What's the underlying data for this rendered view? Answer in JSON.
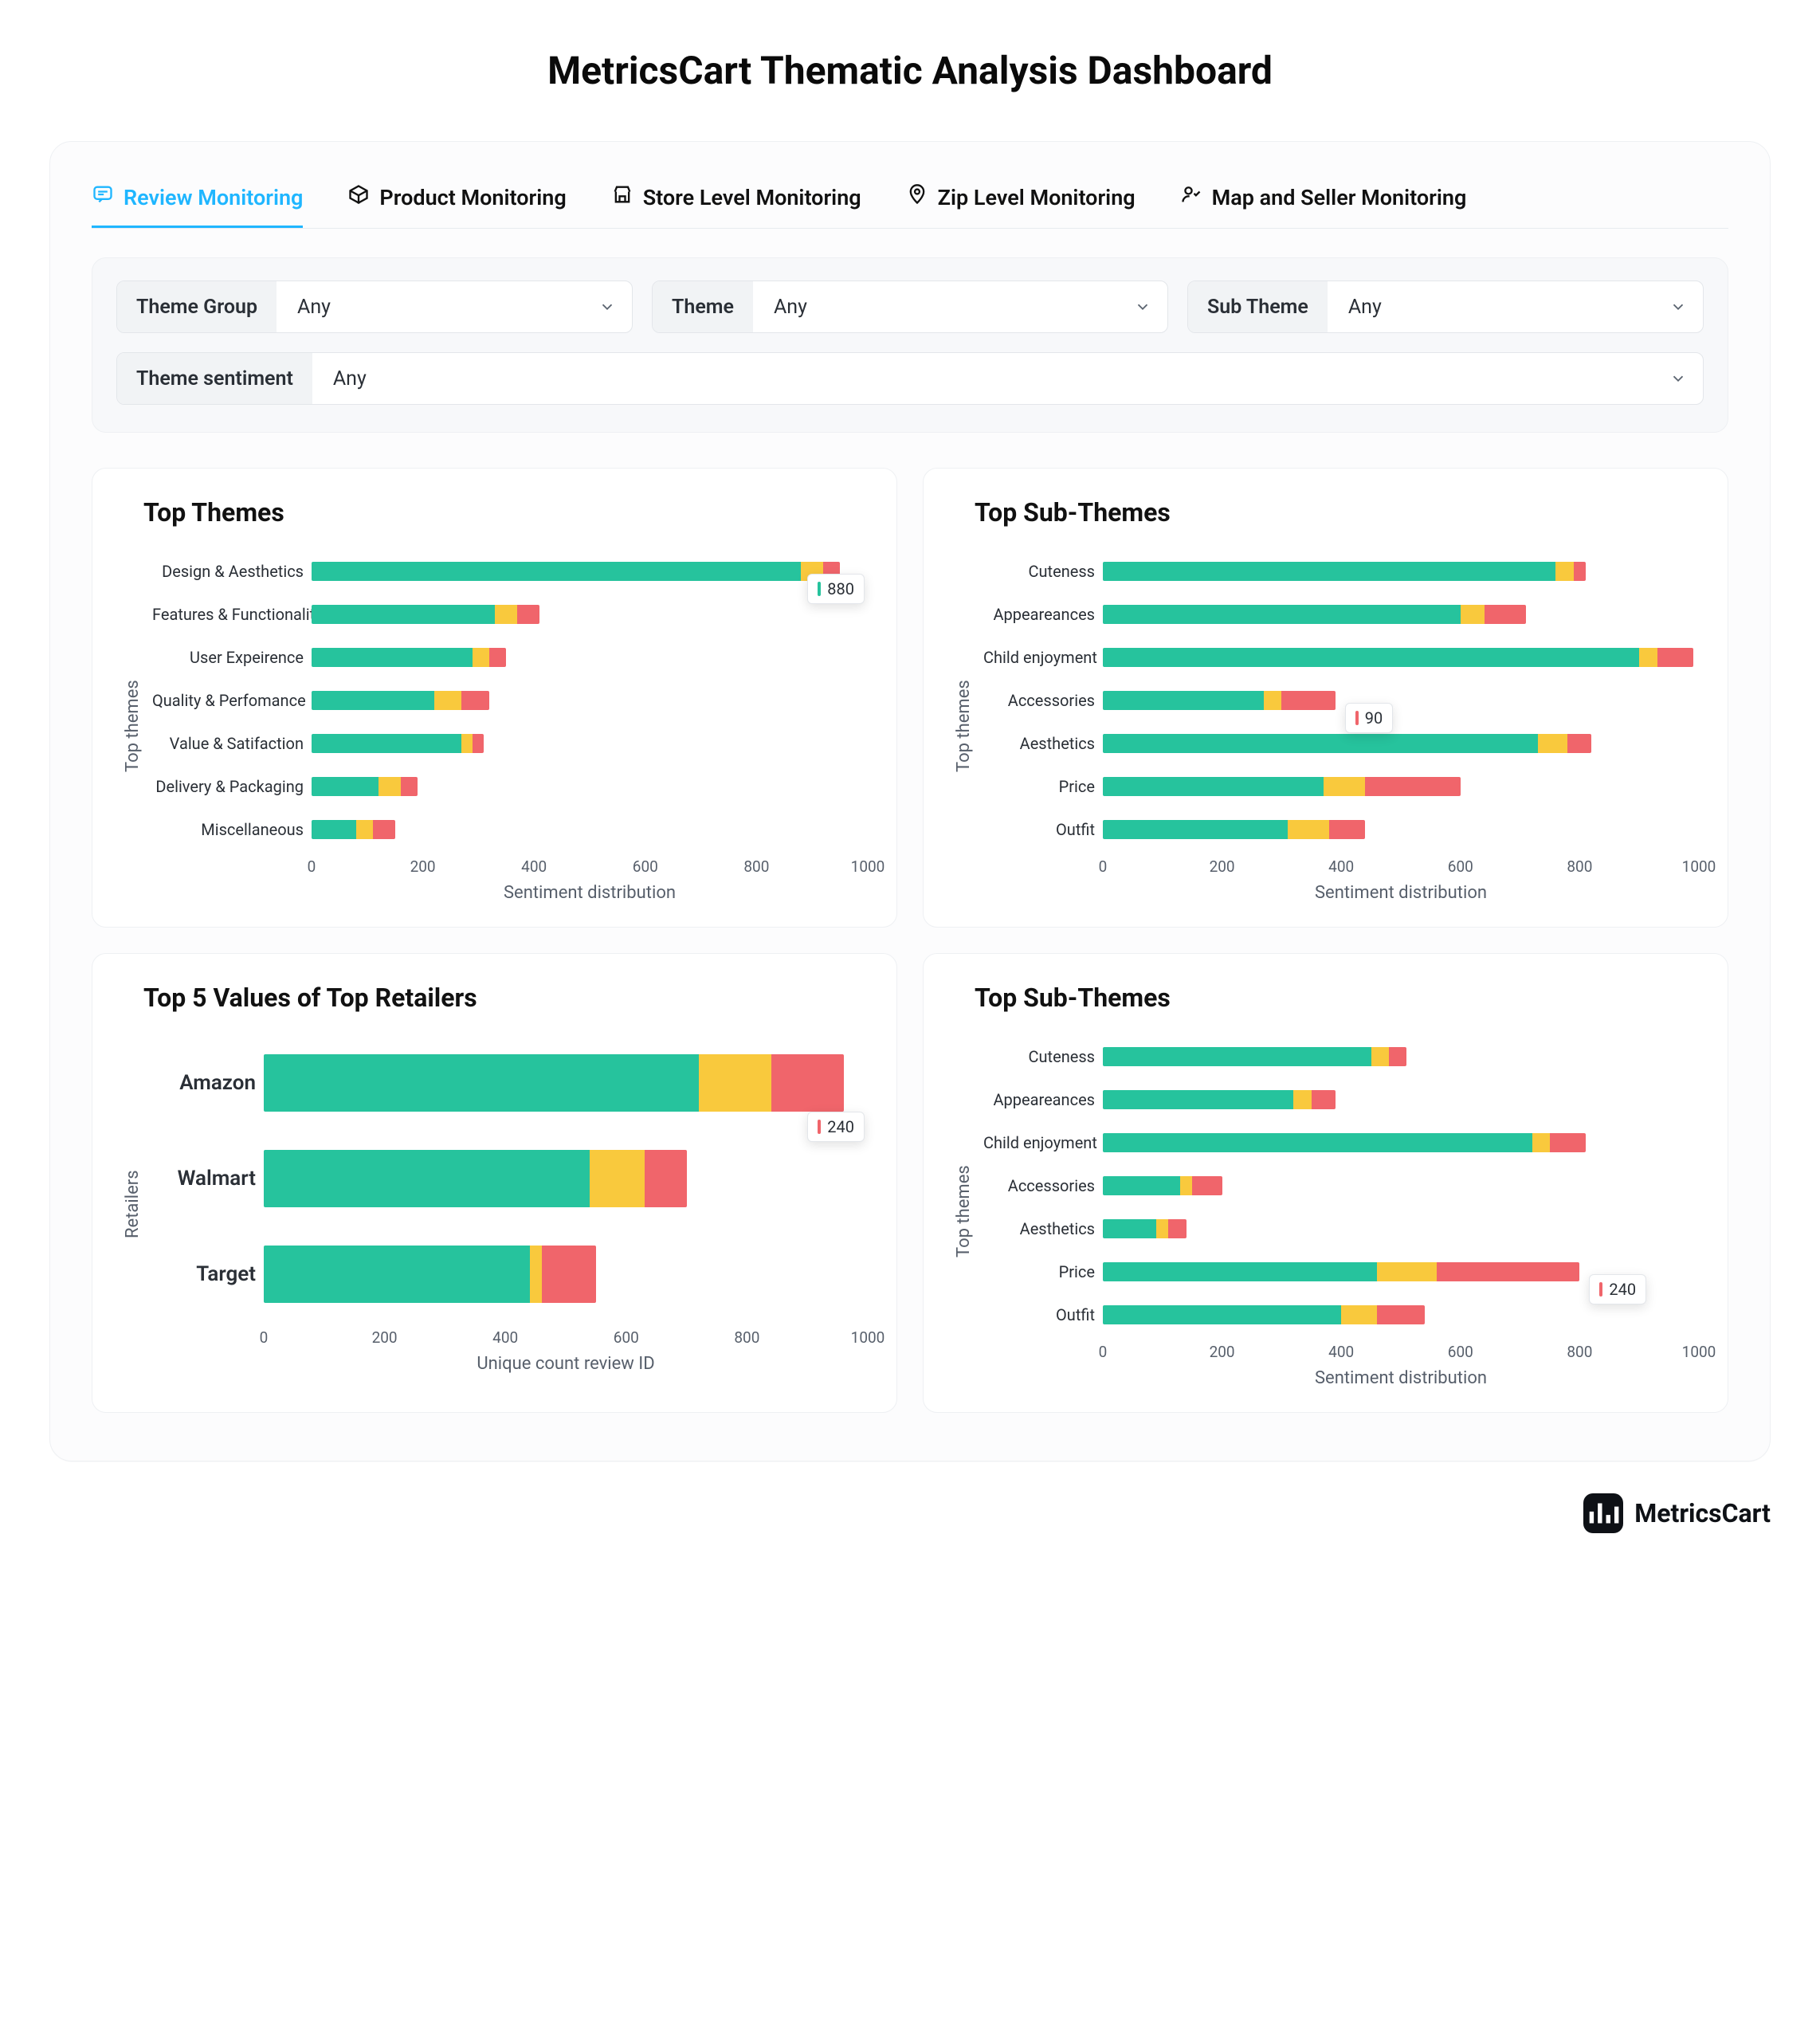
{
  "page": {
    "title": "MetricsCart Thematic Analysis Dashboard"
  },
  "tabs": [
    {
      "label": "Review Monitoring",
      "active": true
    },
    {
      "label": "Product Monitoring"
    },
    {
      "label": "Store Level Monitoring"
    },
    {
      "label": "Zip Level  Monitoring"
    },
    {
      "label": "Map and Seller Monitoring"
    }
  ],
  "filters": {
    "theme_group": {
      "label": "Theme Group",
      "value": "Any"
    },
    "theme": {
      "label": "Theme",
      "value": "Any"
    },
    "sub_theme": {
      "label": "Sub Theme",
      "value": "Any"
    },
    "sentiment": {
      "label": "Theme sentiment",
      "value": "Any"
    }
  },
  "colors": {
    "positive": "#26c39d",
    "neutral": "#f9c93d",
    "negative": "#f0656b",
    "accent": "#1fb6ff"
  },
  "charts": {
    "top_themes": {
      "title": "Top Themes",
      "ylabel": "Top themes",
      "xlabel": "Sentiment distribution",
      "xmax": 1000,
      "xticks": [
        0,
        200,
        400,
        600,
        800,
        1000
      ],
      "tooltip": {
        "row": 0,
        "value": 880,
        "series": "positive"
      }
    },
    "top_sub_themes_1": {
      "title": "Top  Sub-Themes",
      "ylabel": "Top themes",
      "xlabel": "Sentiment distribution",
      "xmax": 1000,
      "xticks": [
        0,
        200,
        400,
        600,
        800,
        1000
      ],
      "tooltip": {
        "row": 3,
        "value": 90,
        "series": "negative"
      }
    },
    "top_retailers": {
      "title": "Top  5 Values of Top Retailers",
      "ylabel": "Retailers",
      "xlabel": "Unique count review ID",
      "xmax": 1000,
      "xticks": [
        0,
        200,
        400,
        600,
        800,
        1000
      ],
      "tooltip": {
        "row": 0,
        "value": 240,
        "series": "negative"
      }
    },
    "top_sub_themes_2": {
      "title": "Top  Sub-Themes",
      "ylabel": "Top themes",
      "xlabel": "Sentiment distribution",
      "xmax": 1000,
      "xticks": [
        0,
        200,
        400,
        600,
        800,
        1000
      ],
      "tooltip": {
        "row": 5,
        "value": 240,
        "series": "negative"
      }
    }
  },
  "chart_data": [
    {
      "id": "top_themes",
      "type": "bar",
      "orientation": "horizontal",
      "stacked": true,
      "title": "Top Themes",
      "xlabel": "Sentiment distribution",
      "ylabel": "Top themes",
      "xlim": [
        0,
        1000
      ],
      "categories": [
        "Design & Aesthetics",
        "Features & Functionality",
        "User Expeirence",
        "Quality & Perfomance",
        "Value & Satifaction",
        "Delivery & Packaging",
        "Miscellaneous"
      ],
      "series": [
        {
          "name": "positive",
          "color": "#26c39d",
          "values": [
            880,
            330,
            290,
            220,
            270,
            120,
            80
          ]
        },
        {
          "name": "neutral",
          "color": "#f9c93d",
          "values": [
            40,
            40,
            30,
            50,
            20,
            40,
            30
          ]
        },
        {
          "name": "negative",
          "color": "#f0656b",
          "values": [
            30,
            40,
            30,
            50,
            20,
            30,
            40
          ]
        }
      ]
    },
    {
      "id": "top_sub_themes_1",
      "type": "bar",
      "orientation": "horizontal",
      "stacked": true,
      "title": "Top Sub-Themes",
      "xlabel": "Sentiment distribution",
      "ylabel": "Top themes",
      "xlim": [
        0,
        1000
      ],
      "categories": [
        "Cuteness",
        "Appeareances",
        "Child enjoyment",
        "Accessories",
        "Aesthetics",
        "Price",
        "Outfit"
      ],
      "series": [
        {
          "name": "positive",
          "color": "#26c39d",
          "values": [
            760,
            600,
            900,
            270,
            730,
            370,
            310
          ]
        },
        {
          "name": "neutral",
          "color": "#f9c93d",
          "values": [
            30,
            40,
            30,
            30,
            50,
            70,
            70
          ]
        },
        {
          "name": "negative",
          "color": "#f0656b",
          "values": [
            20,
            70,
            60,
            90,
            40,
            160,
            60
          ]
        }
      ]
    },
    {
      "id": "top_retailers",
      "type": "bar",
      "orientation": "horizontal",
      "stacked": true,
      "title": "Top 5 Values of Top Retailers",
      "xlabel": "Unique count review ID",
      "ylabel": "Retailers",
      "xlim": [
        0,
        1000
      ],
      "categories": [
        "Amazon",
        "Walmart",
        "Target"
      ],
      "series": [
        {
          "name": "positive",
          "color": "#26c39d",
          "values": [
            720,
            540,
            440
          ]
        },
        {
          "name": "neutral",
          "color": "#f9c93d",
          "values": [
            120,
            90,
            20
          ]
        },
        {
          "name": "negative",
          "color": "#f0656b",
          "values": [
            120,
            70,
            90
          ]
        }
      ]
    },
    {
      "id": "top_sub_themes_2",
      "type": "bar",
      "orientation": "horizontal",
      "stacked": true,
      "title": "Top Sub-Themes",
      "xlabel": "Sentiment distribution",
      "ylabel": "Top themes",
      "xlim": [
        0,
        1000
      ],
      "categories": [
        "Cuteness",
        "Appeareances",
        "Child enjoyment",
        "Accessories",
        "Aesthetics",
        "Price",
        "Outfit"
      ],
      "series": [
        {
          "name": "positive",
          "color": "#26c39d",
          "values": [
            450,
            320,
            720,
            130,
            90,
            460,
            400
          ]
        },
        {
          "name": "neutral",
          "color": "#f9c93d",
          "values": [
            30,
            30,
            30,
            20,
            20,
            100,
            60
          ]
        },
        {
          "name": "negative",
          "color": "#f0656b",
          "values": [
            30,
            40,
            60,
            50,
            30,
            240,
            80
          ]
        }
      ]
    }
  ],
  "footer": {
    "brand": "MetricsCart"
  }
}
